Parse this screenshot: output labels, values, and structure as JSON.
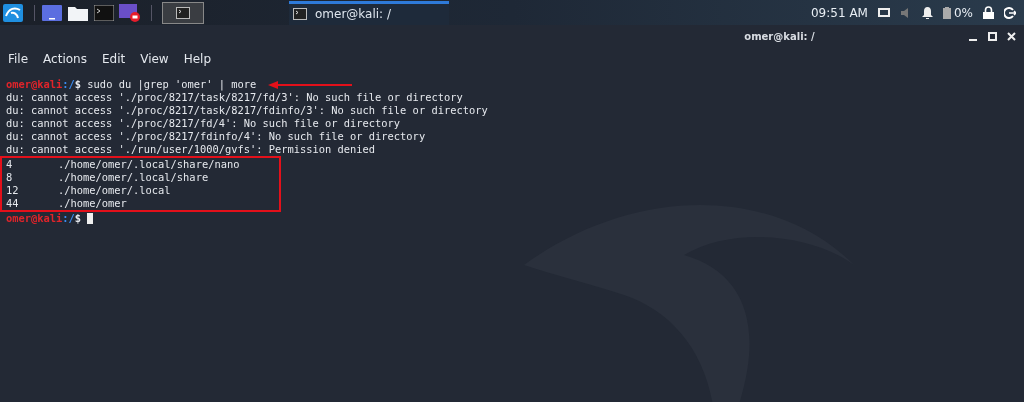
{
  "taskbar": {
    "launchers": [
      {
        "kind": "menu"
      },
      {
        "kind": "desktop"
      },
      {
        "kind": "files"
      },
      {
        "kind": "terminal"
      },
      {
        "kind": "recorder"
      }
    ],
    "workspace": {
      "selected": true
    },
    "window_button": {
      "title": "omer@kali: /",
      "selected": true
    },
    "clock": "09:51 AM",
    "battery": "0%"
  },
  "window": {
    "title": "omer@kali: /"
  },
  "menu": [
    "File",
    "Actions",
    "Edit",
    "View",
    "Help"
  ],
  "terminal": {
    "lines": [
      {
        "kind": "prompt",
        "user": "omer@kali",
        "path": ":/",
        "symbol": "$",
        "command": "sudo du |grep 'omer' | more",
        "cursor": false,
        "arrow": true
      },
      {
        "kind": "output",
        "text": "du: cannot access './proc/8217/task/8217/fd/3': No such file or directory"
      },
      {
        "kind": "output",
        "text": "du: cannot access './proc/8217/task/8217/fdinfo/3': No such file or directory"
      },
      {
        "kind": "output",
        "text": "du: cannot access './proc/8217/fd/4': No such file or directory"
      },
      {
        "kind": "output",
        "text": "du: cannot access './proc/8217/fdinfo/4': No such file or directory"
      },
      {
        "kind": "output",
        "text": "du: cannot access './run/user/1000/gvfs': Permission denied"
      },
      {
        "kind": "usage",
        "highlighted": true,
        "rows": [
          {
            "size": "4",
            "path": "./home/omer/.local/share/nano"
          },
          {
            "size": "8",
            "path": "./home/omer/.local/share"
          },
          {
            "size": "12",
            "path": "./home/omer/.local"
          },
          {
            "size": "44",
            "path": "./home/omer"
          }
        ]
      },
      {
        "kind": "prompt",
        "user": "omer@kali",
        "path": ":/",
        "symbol": "$",
        "cursor": true,
        "arrow": false
      }
    ]
  }
}
